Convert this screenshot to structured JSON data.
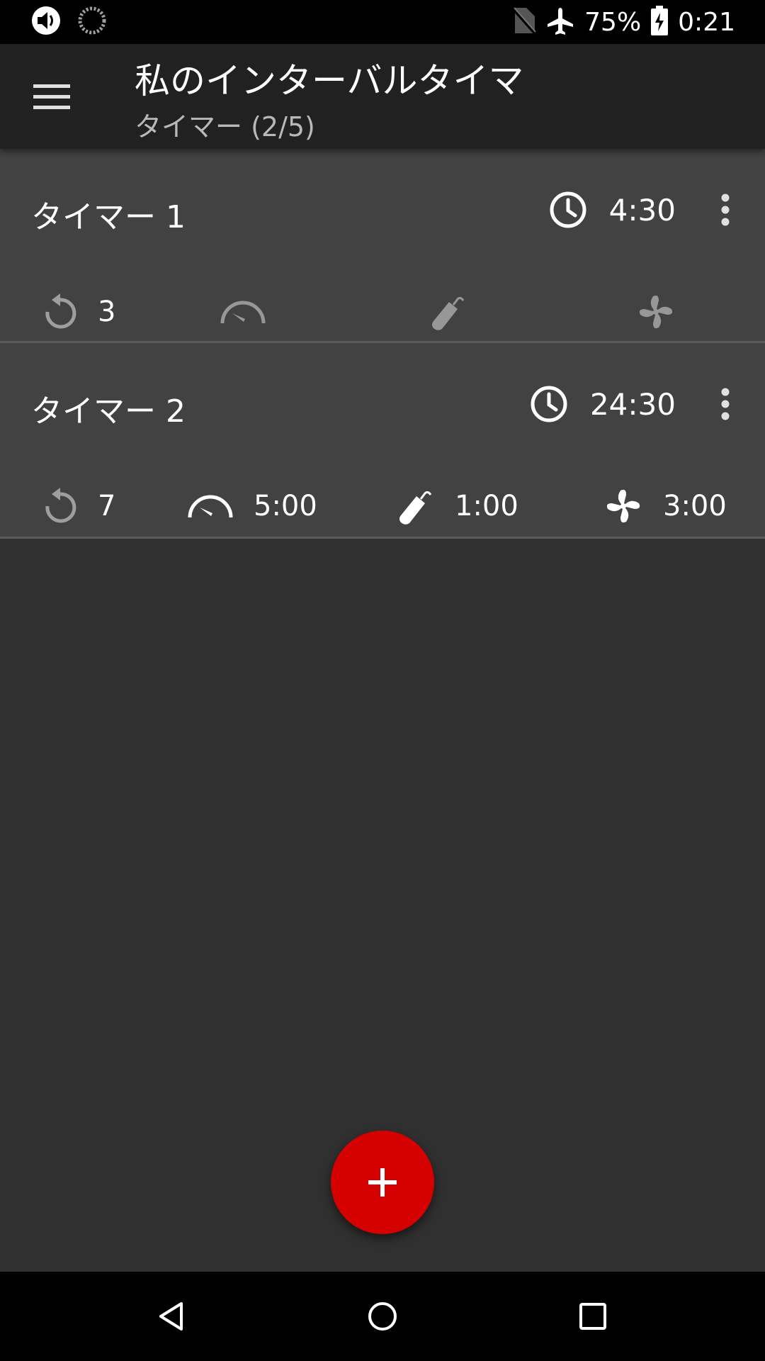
{
  "status_bar": {
    "battery": "75%",
    "time": "0:21",
    "icons": [
      "volume-icon",
      "sync-icon",
      "no-sim-icon",
      "airplane-icon",
      "battery-charging-icon"
    ]
  },
  "app_bar": {
    "title": "私のインターバルタイマ",
    "subtitle": "タイマー (2/5)",
    "menu_icon": "hamburger-menu-icon"
  },
  "timers": [
    {
      "name": "タイマー 1",
      "total": "4:30",
      "repeat": "3",
      "warmup": "",
      "work": "",
      "cooldown": "",
      "stats_dimmed": true
    },
    {
      "name": "タイマー 2",
      "total": "24:30",
      "repeat": "7",
      "warmup": "5:00",
      "work": "1:00",
      "cooldown": "3:00",
      "stats_dimmed": false
    }
  ],
  "fab": {
    "icon": "plus-icon"
  },
  "nav": {
    "icons": [
      "back-icon",
      "home-icon",
      "recents-icon"
    ]
  },
  "colors": {
    "accent": "#d50000",
    "card": "#424242",
    "background": "#303030",
    "app_bar": "#212121"
  }
}
